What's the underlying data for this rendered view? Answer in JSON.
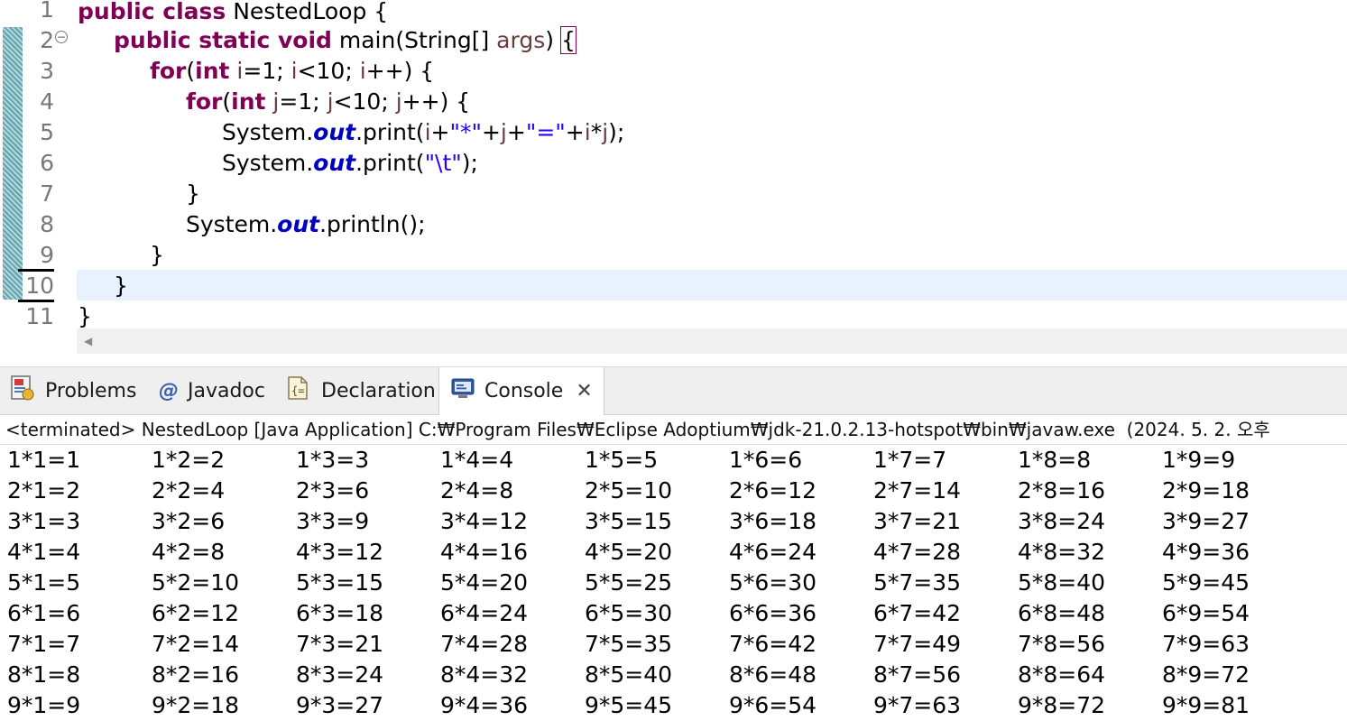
{
  "editor": {
    "line_numbers": [
      "1",
      "2",
      "3",
      "4",
      "5",
      "6",
      "7",
      "8",
      "9",
      "10",
      "11"
    ],
    "fold_icon": "collapse-minus-icon",
    "scroll_left_glyph": "◀",
    "code": {
      "l1": {
        "kw": "public class",
        "rest": " NestedLoop {"
      },
      "l2": {
        "kw": "public static void",
        "mid": " main(String[] ",
        "var": "args",
        "close": ")",
        "brace": "{"
      },
      "l3": {
        "kw": "for",
        "p1": "(",
        "kw2": "int",
        "v1": " i",
        "t1": "=1; ",
        "v2": "i",
        "t2": "<10; ",
        "v3": "i",
        "t3": "++) {"
      },
      "l4": {
        "kw": "for",
        "p1": "(",
        "kw2": "int",
        "v1": " j",
        "t1": "=1; ",
        "v2": "j",
        "t2": "<10; ",
        "v3": "j",
        "t3": "++) {"
      },
      "l5": {
        "a": "System.",
        "fld": "out",
        "b": ".print(",
        "v1": "i",
        "c": "+",
        "s1": "\"*\"",
        "d": "+",
        "v2": "j",
        "e": "+",
        "s2": "\"=\"",
        "f": "+",
        "v3": "i",
        "g": "*",
        "v4": "j",
        "h": ");"
      },
      "l6": {
        "a": "System.",
        "fld": "out",
        "b": ".print(",
        "s1": "\"\\t\"",
        "c": ");"
      },
      "l7": "}",
      "l8": {
        "a": "System.",
        "fld": "out",
        "b": ".println();"
      },
      "l9": "}",
      "l10": "}",
      "l11": "}"
    }
  },
  "panel": {
    "tabs": [
      {
        "label": "Problems",
        "icon": "problems-icon"
      },
      {
        "label": "Javadoc",
        "icon": "at-icon"
      },
      {
        "label": "Declaration",
        "icon": "declaration-icon"
      },
      {
        "label": "Console",
        "icon": "console-icon",
        "active": true,
        "close": "✕"
      }
    ],
    "console_status": "<terminated> NestedLoop [Java Application] C:₩Program Files₩Eclipse Adoptium₩jdk-21.0.2.13-hotspot₩bin₩javaw.exe  (2024. 5. 2. 오후",
    "output_rows": [
      [
        "1*1=1",
        "1*2=2",
        "1*3=3",
        "1*4=4",
        "1*5=5",
        "1*6=6",
        "1*7=7",
        "1*8=8",
        "1*9=9"
      ],
      [
        "2*1=2",
        "2*2=4",
        "2*3=6",
        "2*4=8",
        "2*5=10",
        "2*6=12",
        "2*7=14",
        "2*8=16",
        "2*9=18"
      ],
      [
        "3*1=3",
        "3*2=6",
        "3*3=9",
        "3*4=12",
        "3*5=15",
        "3*6=18",
        "3*7=21",
        "3*8=24",
        "3*9=27"
      ],
      [
        "4*1=4",
        "4*2=8",
        "4*3=12",
        "4*4=16",
        "4*5=20",
        "4*6=24",
        "4*7=28",
        "4*8=32",
        "4*9=36"
      ],
      [
        "5*1=5",
        "5*2=10",
        "5*3=15",
        "5*4=20",
        "5*5=25",
        "5*6=30",
        "5*7=35",
        "5*8=40",
        "5*9=45"
      ],
      [
        "6*1=6",
        "6*2=12",
        "6*3=18",
        "6*4=24",
        "6*5=30",
        "6*6=36",
        "6*7=42",
        "6*8=48",
        "6*9=54"
      ],
      [
        "7*1=7",
        "7*2=14",
        "7*3=21",
        "7*4=28",
        "7*5=35",
        "7*6=42",
        "7*7=49",
        "7*8=56",
        "7*9=63"
      ],
      [
        "8*1=8",
        "8*2=16",
        "8*3=24",
        "8*4=32",
        "8*5=40",
        "8*6=48",
        "8*7=56",
        "8*8=64",
        "8*9=72"
      ],
      [
        "9*1=9",
        "9*2=18",
        "9*3=27",
        "9*4=36",
        "9*5=45",
        "9*6=54",
        "9*7=63",
        "9*8=72",
        "9*9=81"
      ]
    ]
  }
}
